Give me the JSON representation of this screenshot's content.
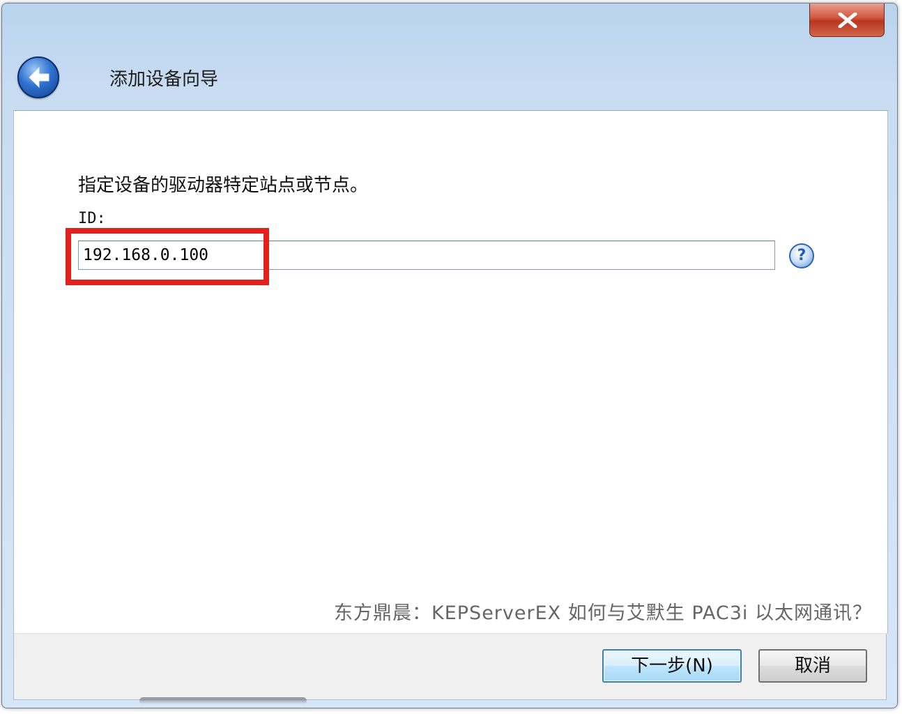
{
  "window": {
    "title": "添加设备向导"
  },
  "content": {
    "instruction": "指定设备的驱动器特定站点或节点。",
    "id_label": "ID:",
    "id_value": "192.168.0.100",
    "help_symbol": "?",
    "footer_note": "东方鼎晨：KEPServerEX 如何与艾默生 PAC3i 以太网通讯？"
  },
  "buttons": {
    "next": "下一步(N)",
    "cancel": "取消"
  },
  "icons": {
    "close": "close-icon",
    "back": "back-arrow-icon",
    "help": "help-icon"
  },
  "colors": {
    "highlight_box": "#e3201b",
    "close_button": "#c9432c",
    "back_button": "#2f72d0"
  }
}
